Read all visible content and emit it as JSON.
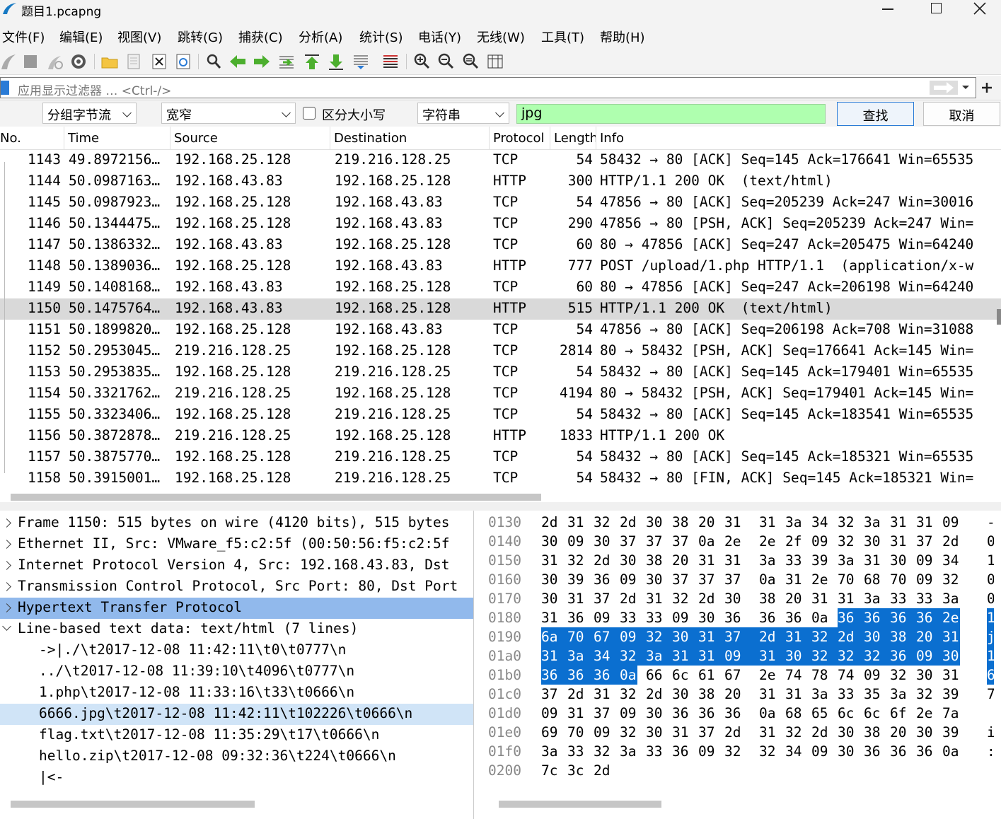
{
  "window": {
    "title": "题目1.pcapng"
  },
  "menu": [
    "文件(F)",
    "编辑(E)",
    "视图(V)",
    "跳转(G)",
    "捕获(C)",
    "分析(A)",
    "统计(S)",
    "电话(Y)",
    "无线(W)",
    "工具(T)",
    "帮助(H)"
  ],
  "filter": {
    "placeholder": "应用显示过滤器 … <Ctrl-/>",
    "value": ""
  },
  "find": {
    "search_in": "分组字节流",
    "char_width": "宽窄",
    "case_label": "区分大小写",
    "case_checked": false,
    "search_type": "字符串",
    "query": "jpg",
    "find_label": "查找",
    "cancel_label": "取消"
  },
  "columns": [
    "No.",
    "Time",
    "Source",
    "Destination",
    "Protocol",
    "Length",
    "Info"
  ],
  "packets": [
    {
      "no": "1143",
      "time": "49.8972156…",
      "src": "192.168.25.128",
      "dst": "219.216.128.25",
      "proto": "TCP",
      "len": "54",
      "info": "58432 → 80 [ACK] Seq=145 Ack=176641 Win=65535"
    },
    {
      "no": "1144",
      "time": "50.0987163…",
      "src": "192.168.43.83",
      "dst": "192.168.25.128",
      "proto": "HTTP",
      "len": "300",
      "info": "HTTP/1.1 200 OK  (text/html)"
    },
    {
      "no": "1145",
      "time": "50.0987923…",
      "src": "192.168.25.128",
      "dst": "192.168.43.83",
      "proto": "TCP",
      "len": "54",
      "info": "47856 → 80 [ACK] Seq=205239 Ack=247 Win=30016"
    },
    {
      "no": "1146",
      "time": "50.1344475…",
      "src": "192.168.25.128",
      "dst": "192.168.43.83",
      "proto": "TCP",
      "len": "290",
      "info": "47856 → 80 [PSH, ACK] Seq=205239 Ack=247 Win="
    },
    {
      "no": "1147",
      "time": "50.1386332…",
      "src": "192.168.43.83",
      "dst": "192.168.25.128",
      "proto": "TCP",
      "len": "60",
      "info": "80 → 47856 [ACK] Seq=247 Ack=205475 Win=64240"
    },
    {
      "no": "1148",
      "time": "50.1389036…",
      "src": "192.168.25.128",
      "dst": "192.168.43.83",
      "proto": "HTTP",
      "len": "777",
      "info": "POST /upload/1.php HTTP/1.1  (application/x-w"
    },
    {
      "no": "1149",
      "time": "50.1408168…",
      "src": "192.168.43.83",
      "dst": "192.168.25.128",
      "proto": "TCP",
      "len": "60",
      "info": "80 → 47856 [ACK] Seq=247 Ack=206198 Win=64240"
    },
    {
      "no": "1150",
      "time": "50.1475764…",
      "src": "192.168.43.83",
      "dst": "192.168.25.128",
      "proto": "HTTP",
      "len": "515",
      "info": "HTTP/1.1 200 OK  (text/html)"
    },
    {
      "no": "1151",
      "time": "50.1899820…",
      "src": "192.168.25.128",
      "dst": "192.168.43.83",
      "proto": "TCP",
      "len": "54",
      "info": "47856 → 80 [ACK] Seq=206198 Ack=708 Win=31088"
    },
    {
      "no": "1152",
      "time": "50.2953045…",
      "src": "219.216.128.25",
      "dst": "192.168.25.128",
      "proto": "TCP",
      "len": "2814",
      "info": "80 → 58432 [PSH, ACK] Seq=176641 Ack=145 Win="
    },
    {
      "no": "1153",
      "time": "50.2953835…",
      "src": "192.168.25.128",
      "dst": "219.216.128.25",
      "proto": "TCP",
      "len": "54",
      "info": "58432 → 80 [ACK] Seq=145 Ack=179401 Win=65535"
    },
    {
      "no": "1154",
      "time": "50.3321762…",
      "src": "219.216.128.25",
      "dst": "192.168.25.128",
      "proto": "TCP",
      "len": "4194",
      "info": "80 → 58432 [PSH, ACK] Seq=179401 Ack=145 Win="
    },
    {
      "no": "1155",
      "time": "50.3323406…",
      "src": "192.168.25.128",
      "dst": "219.216.128.25",
      "proto": "TCP",
      "len": "54",
      "info": "58432 → 80 [ACK] Seq=145 Ack=183541 Win=65535"
    },
    {
      "no": "1156",
      "time": "50.3872878…",
      "src": "219.216.128.25",
      "dst": "192.168.25.128",
      "proto": "HTTP",
      "len": "1833",
      "info": "HTTP/1.1 200 OK"
    },
    {
      "no": "1157",
      "time": "50.3875770…",
      "src": "192.168.25.128",
      "dst": "219.216.128.25",
      "proto": "TCP",
      "len": "54",
      "info": "58432 → 80 [ACK] Seq=145 Ack=185321 Win=65535"
    },
    {
      "no": "1158",
      "time": "50.3915001…",
      "src": "192.168.25.128",
      "dst": "219.216.128.25",
      "proto": "TCP",
      "len": "54",
      "info": "58432 → 80 [FIN, ACK] Seq=145 Ack=185321 Win="
    }
  ],
  "selected_packet": "1150",
  "details": [
    {
      "text": "Frame 1150: 515 bytes on wire (4120 bits), 515 bytes",
      "expander": "collapsed"
    },
    {
      "text": "Ethernet II, Src: VMware_f5:c2:5f (00:50:56:f5:c2:5f",
      "expander": "collapsed"
    },
    {
      "text": "Internet Protocol Version 4, Src: 192.168.43.83, Dst",
      "expander": "collapsed"
    },
    {
      "text": "Transmission Control Protocol, Src Port: 80, Dst Port",
      "expander": "collapsed"
    },
    {
      "text": "Hypertext Transfer Protocol",
      "expander": "collapsed",
      "selected": true
    },
    {
      "text": "Line-based text data: text/html (7 lines)",
      "expander": "expanded"
    },
    {
      "text": "->|./\\t2017-12-08 11:42:11\\t0\\t0777\\n",
      "child": true
    },
    {
      "text": "../\\t2017-12-08 11:39:10\\t4096\\t0777\\n",
      "child": true
    },
    {
      "text": "1.php\\t2017-12-08 11:33:16\\t33\\t0666\\n",
      "child": true
    },
    {
      "text": "6666.jpg\\t2017-12-08 11:42:11\\t102226\\t0666\\n",
      "child": true,
      "highlight": true
    },
    {
      "text": "flag.txt\\t2017-12-08 11:35:29\\t17\\t0666\\n",
      "child": true
    },
    {
      "text": "hello.zip\\t2017-12-08 09:32:36\\t224\\t0666\\n",
      "child": true
    },
    {
      "text": "|<-",
      "child": true
    }
  ],
  "hex": [
    {
      "offset": "0130",
      "bytes": [
        "2d",
        "31",
        "32",
        "2d",
        "30",
        "38",
        "20",
        "31",
        "31",
        "3a",
        "34",
        "32",
        "3a",
        "31",
        "31",
        "09"
      ],
      "ascii": "-"
    },
    {
      "offset": "0140",
      "bytes": [
        "30",
        "09",
        "30",
        "37",
        "37",
        "37",
        "0a",
        "2e",
        "2e",
        "2f",
        "09",
        "32",
        "30",
        "31",
        "37",
        "2d"
      ],
      "ascii": "0"
    },
    {
      "offset": "0150",
      "bytes": [
        "31",
        "32",
        "2d",
        "30",
        "38",
        "20",
        "31",
        "31",
        "3a",
        "33",
        "39",
        "3a",
        "31",
        "30",
        "09",
        "34"
      ],
      "ascii": "1"
    },
    {
      "offset": "0160",
      "bytes": [
        "30",
        "39",
        "36",
        "09",
        "30",
        "37",
        "37",
        "37",
        "0a",
        "31",
        "2e",
        "70",
        "68",
        "70",
        "09",
        "32"
      ],
      "ascii": "0"
    },
    {
      "offset": "0170",
      "bytes": [
        "30",
        "31",
        "37",
        "2d",
        "31",
        "32",
        "2d",
        "30",
        "38",
        "20",
        "31",
        "31",
        "3a",
        "33",
        "33",
        "3a"
      ],
      "ascii": "0"
    },
    {
      "offset": "0180",
      "bytes": [
        "31",
        "36",
        "09",
        "33",
        "33",
        "09",
        "30",
        "36",
        "36",
        "36",
        "0a",
        "36",
        "36",
        "36",
        "36",
        "2e"
      ],
      "ascii": "1",
      "sel_from": 11
    },
    {
      "offset": "0190",
      "bytes": [
        "6a",
        "70",
        "67",
        "09",
        "32",
        "30",
        "31",
        "37",
        "2d",
        "31",
        "32",
        "2d",
        "30",
        "38",
        "20",
        "31"
      ],
      "ascii": "j",
      "sel_from": 0
    },
    {
      "offset": "01a0",
      "bytes": [
        "31",
        "3a",
        "34",
        "32",
        "3a",
        "31",
        "31",
        "09",
        "31",
        "30",
        "32",
        "32",
        "32",
        "36",
        "09",
        "30"
      ],
      "ascii": "1",
      "sel_from": 0
    },
    {
      "offset": "01b0",
      "bytes": [
        "36",
        "36",
        "36",
        "0a",
        "66",
        "6c",
        "61",
        "67",
        "2e",
        "74",
        "78",
        "74",
        "09",
        "32",
        "30",
        "31"
      ],
      "ascii": "6",
      "sel_from": 0,
      "sel_to": 3
    },
    {
      "offset": "01c0",
      "bytes": [
        "37",
        "2d",
        "31",
        "32",
        "2d",
        "30",
        "38",
        "20",
        "31",
        "31",
        "3a",
        "33",
        "35",
        "3a",
        "32",
        "39"
      ],
      "ascii": "7"
    },
    {
      "offset": "01d0",
      "bytes": [
        "09",
        "31",
        "37",
        "09",
        "30",
        "36",
        "36",
        "36",
        "0a",
        "68",
        "65",
        "6c",
        "6c",
        "6f",
        "2e",
        "7a"
      ],
      "ascii": ""
    },
    {
      "offset": "01e0",
      "bytes": [
        "69",
        "70",
        "09",
        "32",
        "30",
        "31",
        "37",
        "2d",
        "31",
        "32",
        "2d",
        "30",
        "38",
        "20",
        "30",
        "39"
      ],
      "ascii": "i"
    },
    {
      "offset": "01f0",
      "bytes": [
        "3a",
        "33",
        "32",
        "3a",
        "33",
        "36",
        "09",
        "32",
        "32",
        "34",
        "09",
        "30",
        "36",
        "36",
        "36",
        "0a"
      ],
      "ascii": ":"
    },
    {
      "offset": "0200",
      "bytes": [
        "7c",
        "3c",
        "2d"
      ],
      "ascii": ""
    }
  ],
  "colors": {
    "selection_blue": "#0b6fd0",
    "tree_selection": "#91b9ec",
    "row_selected": "#d9d9d9",
    "find_field_bg": "#afffaf"
  }
}
